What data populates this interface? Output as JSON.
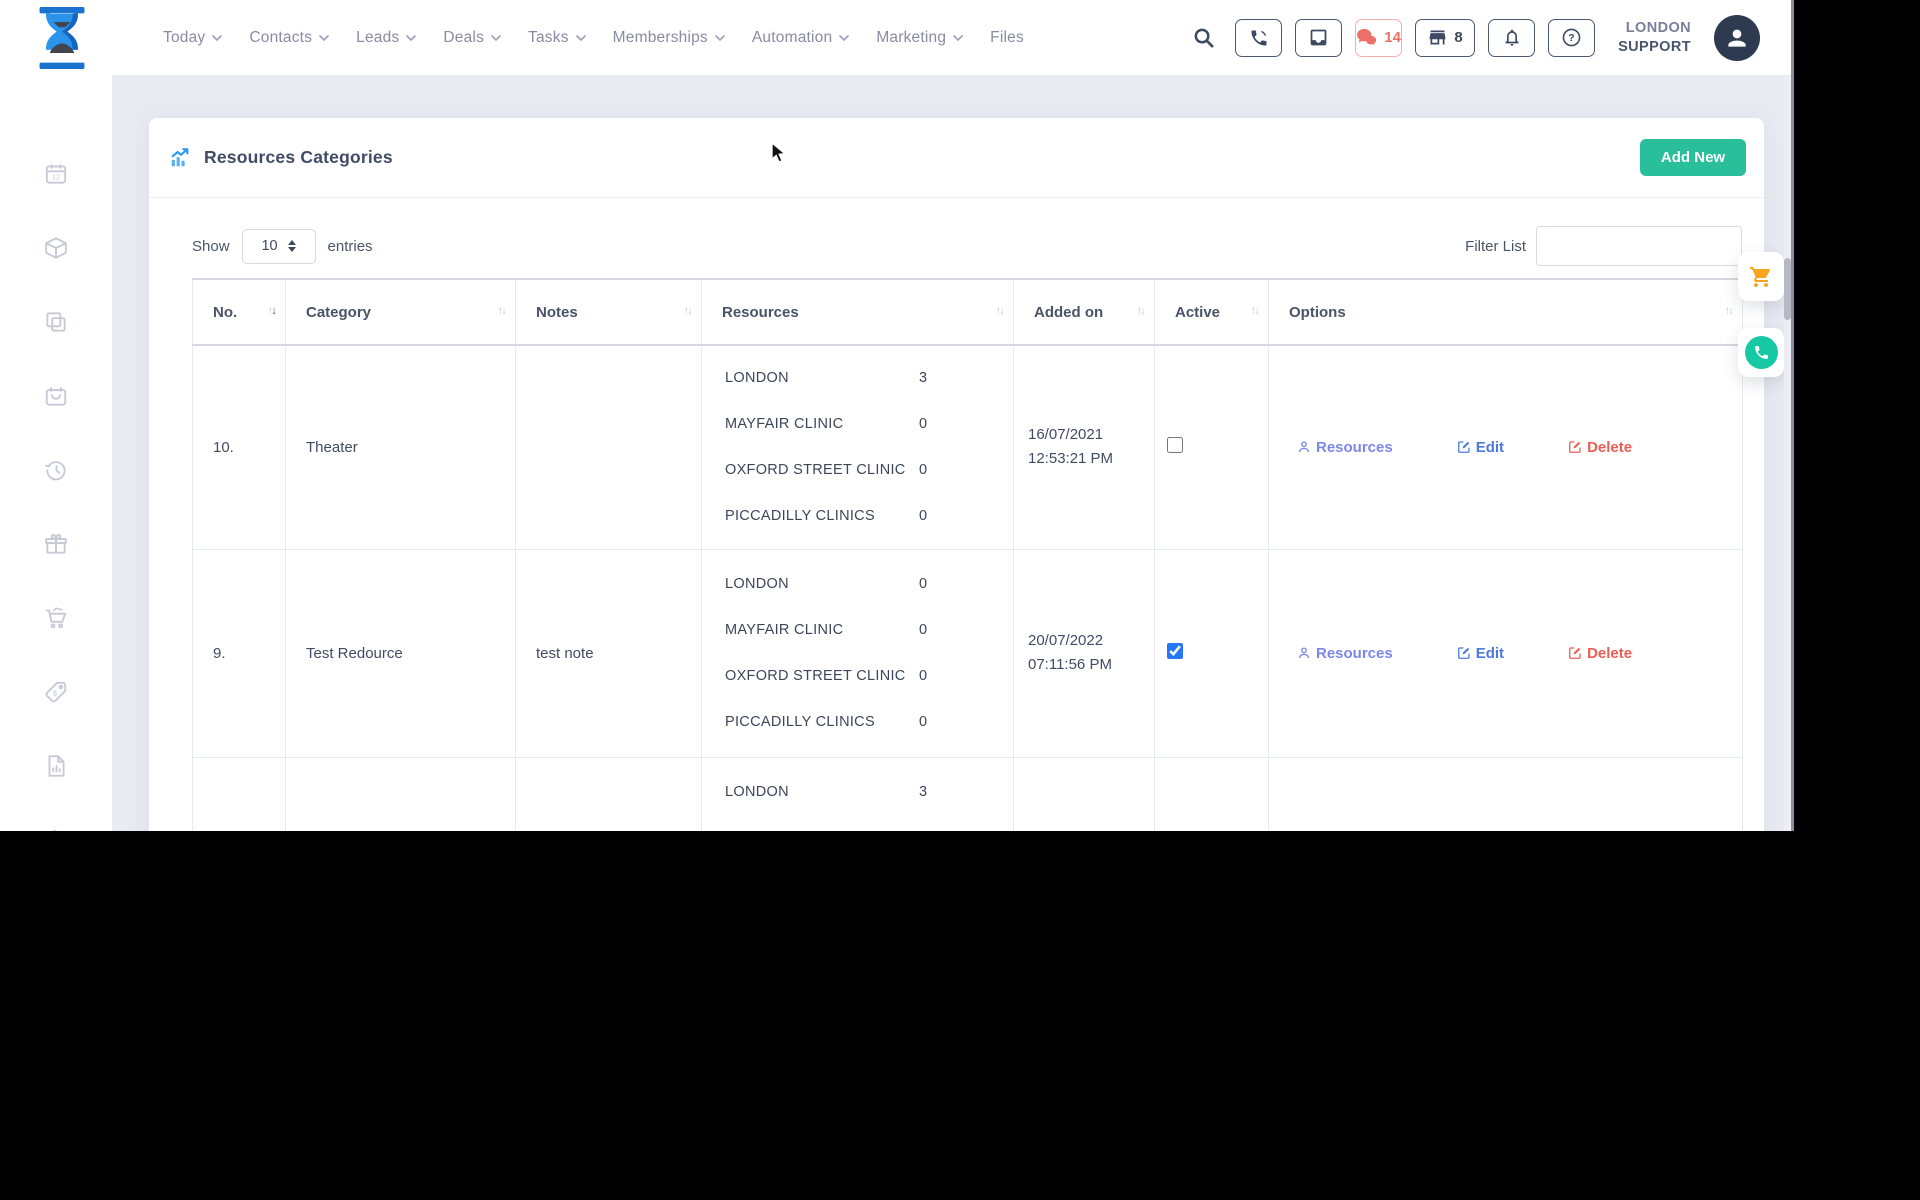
{
  "nav": {
    "items": [
      {
        "label": "Today"
      },
      {
        "label": "Contacts"
      },
      {
        "label": "Leads"
      },
      {
        "label": "Deals"
      },
      {
        "label": "Tasks"
      },
      {
        "label": "Memberships"
      },
      {
        "label": "Automation"
      },
      {
        "label": "Marketing"
      },
      {
        "label": "Files"
      }
    ]
  },
  "topbar": {
    "chat_count": "14",
    "store_count": "8",
    "user": {
      "line1": "LONDON",
      "line2": "SUPPORT"
    },
    "icons": [
      "search-icon",
      "phone-icon",
      "inbox-icon",
      "chat-icon",
      "store-icon",
      "bell-icon",
      "help-icon",
      "user-avatar-icon"
    ]
  },
  "sidebar": {
    "icons": [
      "calendar-12",
      "package-box",
      "copy-pages",
      "reminder-basket",
      "history-clock",
      "gift",
      "shopping-cart",
      "price-tag",
      "report-document",
      "settings-gear"
    ]
  },
  "page": {
    "title": "Resources Categories",
    "add_new_label": "Add New",
    "show_label": "Show",
    "page_size": "10",
    "entries_label": "entries",
    "filter_label": "Filter List",
    "filter_value": ""
  },
  "table": {
    "headers": [
      "No.",
      "Category",
      "Notes",
      "Resources",
      "Added on",
      "Active",
      "Options"
    ],
    "rows": [
      {
        "no": "10.",
        "category": "Theater",
        "notes": "",
        "resources": [
          {
            "name": "LONDON",
            "count": "3"
          },
          {
            "name": "MAYFAIR CLINIC",
            "count": "0"
          },
          {
            "name": "OXFORD STREET CLINIC",
            "count": "0"
          },
          {
            "name": "PICCADILLY CLINICS",
            "count": "0"
          }
        ],
        "added_date": "16/07/2021",
        "added_time": "12:53:21 PM",
        "active": false,
        "checked_attr": null,
        "options": {
          "resources": "Resources",
          "edit": "Edit",
          "delete": "Delete"
        }
      },
      {
        "no": "9.",
        "category": "Test Redource",
        "notes": "test note",
        "resources": [
          {
            "name": "LONDON",
            "count": "0"
          },
          {
            "name": "MAYFAIR CLINIC",
            "count": "0"
          },
          {
            "name": "OXFORD STREET CLINIC",
            "count": "0"
          },
          {
            "name": "PICCADILLY CLINICS",
            "count": "0"
          }
        ],
        "added_date": "20/07/2022",
        "added_time": "07:11:56 PM",
        "active": true,
        "checked_attr": "checked",
        "options": {
          "resources": "Resources",
          "edit": "Edit",
          "delete": "Delete"
        }
      },
      {
        "no": "",
        "category": "",
        "notes": "",
        "resources": [
          {
            "name": "LONDON",
            "count": "3"
          }
        ],
        "added_date": "",
        "added_time": "",
        "active": false,
        "checked_attr": null
      }
    ]
  },
  "colors": {
    "accent_green": "#29bf9b",
    "brand_blue": "#1f87e8",
    "link_purple": "#7d87e9",
    "link_blue": "#4c79e0",
    "link_red": "#ee5d54",
    "badge_red": "#ee6f67",
    "checkbox_blue": "#2577f6",
    "cart_orange": "#f7a422",
    "phone_teal": "#17c8a5",
    "page_bg": "#e9ebf2"
  }
}
